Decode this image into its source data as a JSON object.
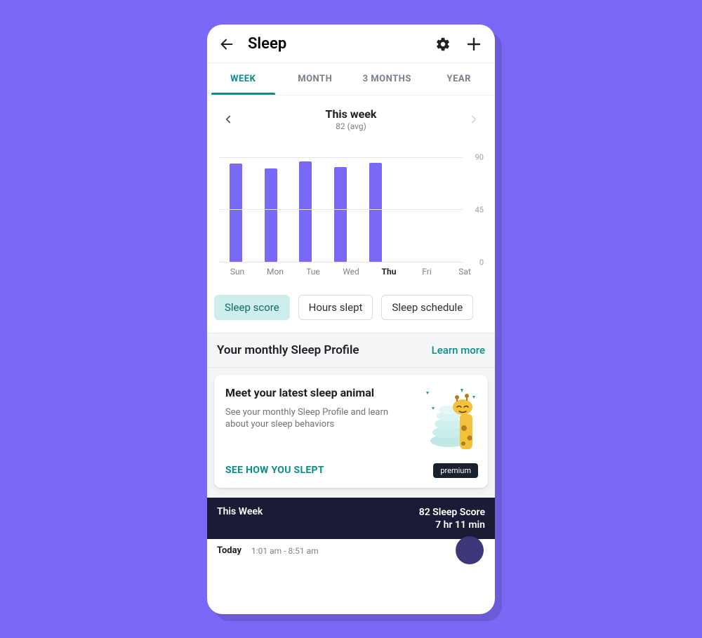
{
  "header": {
    "title": "Sleep"
  },
  "tabs": [
    {
      "label": "WEEK",
      "active": true
    },
    {
      "label": "MONTH",
      "active": false
    },
    {
      "label": "3 MONTHS",
      "active": false
    },
    {
      "label": "YEAR",
      "active": false
    }
  ],
  "period": {
    "title": "This week",
    "subtitle": "82 (avg)"
  },
  "chips": [
    {
      "label": "Sleep score",
      "active": true
    },
    {
      "label": "Hours slept",
      "active": false
    },
    {
      "label": "Sleep schedule",
      "active": false
    }
  ],
  "profile": {
    "heading": "Your monthly Sleep Profile",
    "link": "Learn more"
  },
  "card": {
    "title": "Meet your latest sleep animal",
    "desc": "See your monthly Sleep Profile and learn about your sleep behaviors",
    "action": "SEE HOW YOU SLEPT",
    "badge": "premium"
  },
  "summary": {
    "label": "This Week",
    "score": "82 Sleep Score",
    "duration": "7 hr 11 min"
  },
  "today": {
    "label": "Today",
    "range": "1:01 am - 8:51 am"
  },
  "chart_data": {
    "type": "bar",
    "categories": [
      "Sun",
      "Mon",
      "Tue",
      "Wed",
      "Thu",
      "Fri",
      "Sat"
    ],
    "values": [
      84,
      80,
      86,
      81,
      85,
      null,
      null
    ],
    "current_index": 4,
    "title": "Sleep score (This week)",
    "xlabel": "",
    "ylabel": "",
    "ylim": [
      0,
      90
    ],
    "yticks": [
      0,
      45,
      90
    ]
  }
}
